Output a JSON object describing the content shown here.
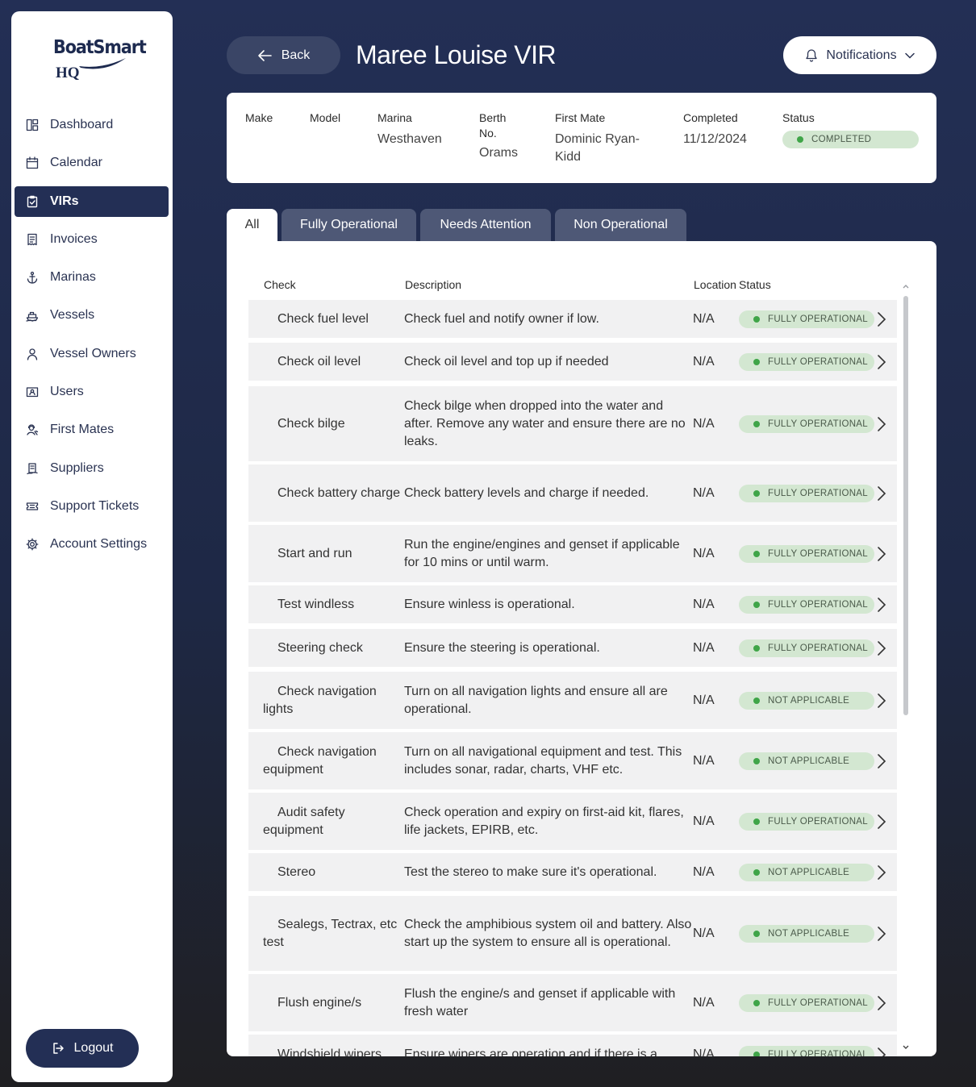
{
  "brand": {
    "line1": "BoatSmart",
    "line2": "HQ"
  },
  "sidebar": {
    "items": [
      {
        "label": "Dashboard",
        "icon": "dashboard-icon"
      },
      {
        "label": "Calendar",
        "icon": "calendar-icon"
      },
      {
        "label": "VIRs",
        "icon": "clipboard-check-icon"
      },
      {
        "label": "Invoices",
        "icon": "receipt-icon"
      },
      {
        "label": "Marinas",
        "icon": "anchor-icon"
      },
      {
        "label": "Vessels",
        "icon": "ship-icon"
      },
      {
        "label": "Vessel Owners",
        "icon": "user-icon"
      },
      {
        "label": "Users",
        "icon": "id-card-icon"
      },
      {
        "label": "First Mates",
        "icon": "worker-icon"
      },
      {
        "label": "Suppliers",
        "icon": "supplier-icon"
      },
      {
        "label": "Support Tickets",
        "icon": "ticket-icon"
      },
      {
        "label": "Account Settings",
        "icon": "gear-icon"
      }
    ],
    "active_index": 2,
    "logout_label": "Logout"
  },
  "header": {
    "back_label": "Back",
    "title": "Maree Louise VIR",
    "notifications_label": "Notifications"
  },
  "info": {
    "make_label": "Make",
    "make_value": "",
    "model_label": "Model",
    "model_value": "",
    "marina_label": "Marina",
    "marina_value": "Westhaven",
    "berth_label": "Berth No.",
    "berth_value": "Orams",
    "first_mate_label": "First Mate",
    "first_mate_value": "Dominic Ryan-Kidd",
    "completed_label": "Completed",
    "completed_value": "11/12/2024",
    "status_label": "Status",
    "status_value": "COMPLETED"
  },
  "tabs": [
    "All",
    "Fully Operational",
    "Needs Attention",
    "Non Operational"
  ],
  "active_tab": 0,
  "table": {
    "headers": {
      "check": "Check",
      "description": "Description",
      "location": "Location",
      "status": "Status"
    },
    "rows": [
      {
        "check": "Check fuel level",
        "description": "Check fuel and notify owner if low.",
        "location": "N/A",
        "status": "FULLY OPERATIONAL"
      },
      {
        "check": "Check oil level",
        "description": "Check oil level and top up if needed",
        "location": "N/A",
        "status": "FULLY OPERATIONAL"
      },
      {
        "check": "Check bilge",
        "description": "Check bilge when dropped into the water and after. Remove any water and ensure there are no leaks.",
        "location": "N/A",
        "status": "FULLY OPERATIONAL"
      },
      {
        "check": "Check battery charge",
        "description": "Check battery levels and charge if needed.",
        "location": "N/A",
        "status": "FULLY OPERATIONAL"
      },
      {
        "check": "Start and run",
        "description": "Run the engine/engines and genset if applicable for 10 mins or until warm.",
        "location": "N/A",
        "status": "FULLY OPERATIONAL"
      },
      {
        "check": "Test windless",
        "description": "Ensure winless is operational.",
        "location": "N/A",
        "status": "FULLY OPERATIONAL"
      },
      {
        "check": "Steering check",
        "description": "Ensure the steering is operational.",
        "location": "N/A",
        "status": "FULLY OPERATIONAL"
      },
      {
        "check": "Check navigation lights",
        "description": "Turn on all navigation lights and ensure all are operational.",
        "location": "N/A",
        "status": "NOT APPLICABLE"
      },
      {
        "check": "Check navigation equipment",
        "description": "Turn on all navigational equipment and test. This includes sonar, radar, charts, VHF etc.",
        "location": "N/A",
        "status": "NOT APPLICABLE"
      },
      {
        "check": "Audit safety equipment",
        "description": "Check operation and expiry on first-aid kit, flares, life jackets, EPIRB, etc.",
        "location": "N/A",
        "status": "FULLY OPERATIONAL"
      },
      {
        "check": "Stereo",
        "description": "Test the stereo to make sure it's operational.",
        "location": "N/A",
        "status": "NOT APPLICABLE"
      },
      {
        "check": "Sealegs, Tectrax, etc test",
        "description": "Check the amphibious system oil and battery. Also start up the system to ensure all is operational.",
        "location": "N/A",
        "status": "NOT APPLICABLE"
      },
      {
        "check": "Flush engine/s",
        "description": "Flush the engine/s and genset if applicable with fresh water",
        "location": "N/A",
        "status": "FULLY OPERATIONAL"
      },
      {
        "check": "Windshield wipers",
        "description": "Ensure wipers are operation and if there is a",
        "location": "N/A",
        "status": "FULLY OPERATIONAL"
      }
    ]
  },
  "colors": {
    "navy": "#232f55",
    "status_green": "#3fa548",
    "status_pill": "#d3e7d1"
  }
}
